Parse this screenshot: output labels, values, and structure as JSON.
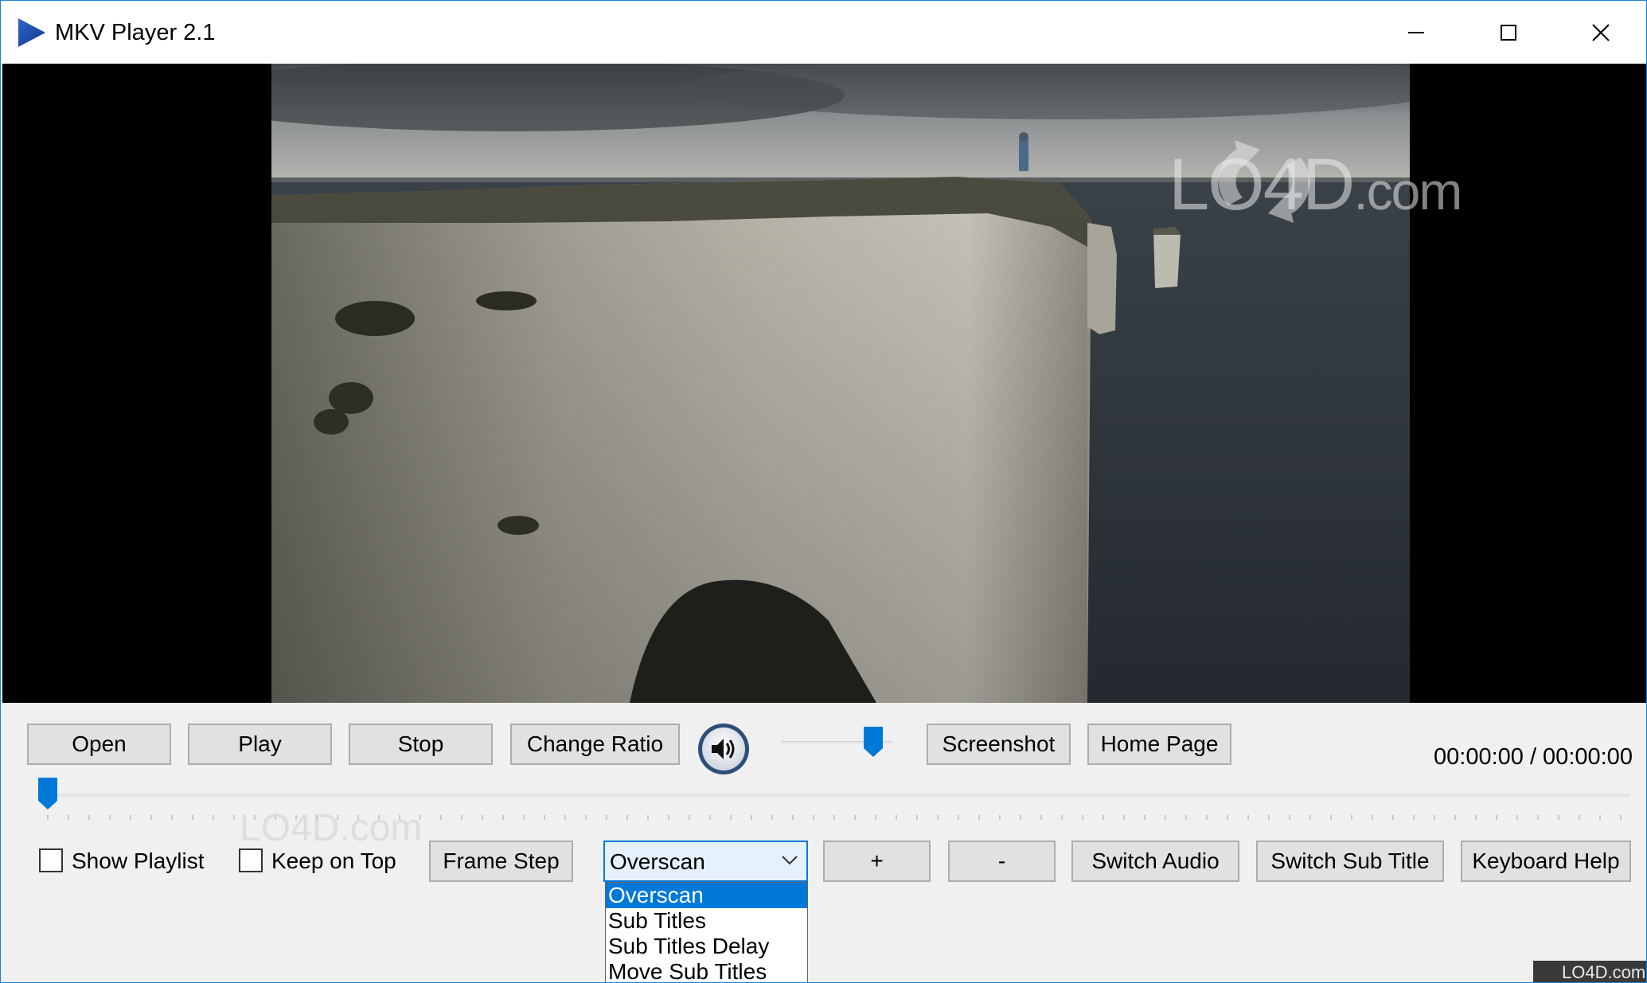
{
  "window": {
    "title": "MKV Player 2.1"
  },
  "video": {
    "watermark": "LO4D",
    "watermark_suffix": ".com"
  },
  "toolbar": {
    "open": "Open",
    "play": "Play",
    "stop": "Stop",
    "change_ratio": "Change Ratio",
    "screenshot": "Screenshot",
    "home_page": "Home Page",
    "time": "00:00:00 /  00:00:00",
    "volume_level": 0.9,
    "seek_position": 0.0
  },
  "options_row": {
    "show_playlist": "Show Playlist",
    "show_playlist_checked": false,
    "keep_on_top": "Keep on Top",
    "keep_on_top_checked": false,
    "frame_step": "Frame Step",
    "plus": "+",
    "minus": "-",
    "switch_audio": "Switch Audio",
    "switch_sub_title": "Switch Sub Title",
    "keyboard_help": "Keyboard Help"
  },
  "mode_combo": {
    "selected": "Overscan",
    "options": [
      "Overscan",
      "Sub Titles",
      "Sub Titles Delay",
      "Move Sub Titles"
    ]
  },
  "bottom_watermark": "LO4D.com",
  "corner_badge": "LO4D.com",
  "colors": {
    "accent": "#0078d7",
    "window_border": "#1883d7",
    "slider_thumb": "#0078d7"
  },
  "icons": [
    "app-play-icon",
    "minimize-icon",
    "maximize-icon",
    "close-icon",
    "speaker-icon",
    "chevron-down-icon"
  ]
}
